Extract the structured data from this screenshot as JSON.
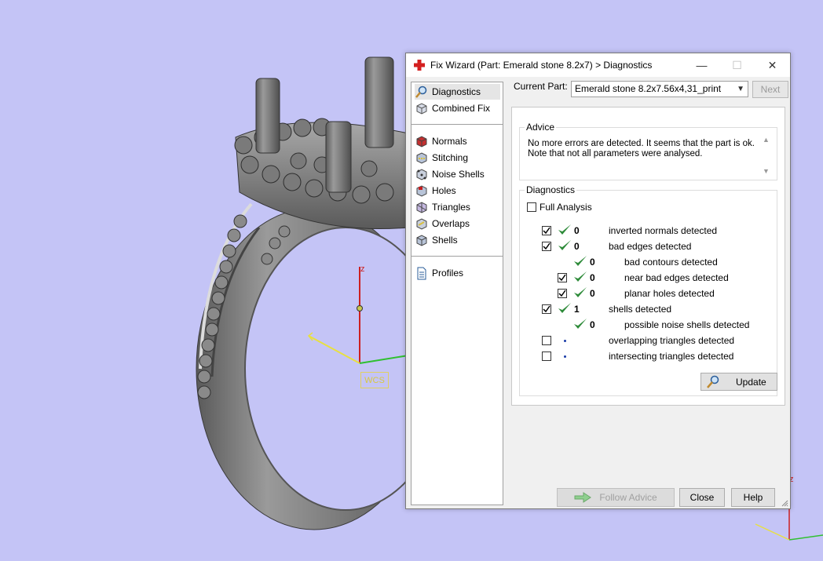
{
  "viewport": {
    "wcs_label": "WCS",
    "axis_z": "z",
    "corner_z": "z"
  },
  "dialog": {
    "title": "Fix Wizard (Part: Emerald stone 8.2x7) > Diagnostics",
    "controls": {
      "minimize": "—",
      "maximize": "☐",
      "close": "✕"
    }
  },
  "nav": {
    "items_top": [
      {
        "label": "Diagnostics",
        "icon": "magnifier-icon",
        "selected": true
      },
      {
        "label": "Combined Fix",
        "icon": "cube-icon"
      }
    ],
    "items_mid": [
      {
        "label": "Normals",
        "icon": "normals-icon"
      },
      {
        "label": "Stitching",
        "icon": "stitching-icon"
      },
      {
        "label": "Noise Shells",
        "icon": "noise-shells-icon"
      },
      {
        "label": "Holes",
        "icon": "holes-icon"
      },
      {
        "label": "Triangles",
        "icon": "triangles-icon"
      },
      {
        "label": "Overlaps",
        "icon": "overlaps-icon"
      },
      {
        "label": "Shells",
        "icon": "shells-icon"
      }
    ],
    "items_bottom": [
      {
        "label": "Profiles",
        "icon": "document-icon"
      }
    ]
  },
  "current_part": {
    "label": "Current Part:",
    "value": "Emerald stone 8.2x7.56x4,31_print",
    "next_label": "Next"
  },
  "advice": {
    "title": "Advice",
    "line1": "No more errors are detected. It seems that the part is ok.",
    "line2": "Note that not all parameters were analysed."
  },
  "diagnostics": {
    "title": "Diagnostics",
    "full_analysis": "Full Analysis",
    "rows": [
      {
        "checkbox": true,
        "checked": true,
        "status": "ok",
        "count": "0",
        "label": "inverted normals detected",
        "indent": 0
      },
      {
        "checkbox": true,
        "checked": true,
        "status": "ok",
        "count": "0",
        "label": "bad edges detected",
        "indent": 0
      },
      {
        "checkbox": false,
        "checked": false,
        "status": "ok",
        "count": "0",
        "label": "bad contours detected",
        "indent": 1
      },
      {
        "checkbox": true,
        "checked": true,
        "status": "ok",
        "count": "0",
        "label": "near bad edges detected",
        "indent": 1
      },
      {
        "checkbox": true,
        "checked": true,
        "status": "ok",
        "count": "0",
        "label": "planar holes detected",
        "indent": 1
      },
      {
        "checkbox": true,
        "checked": true,
        "status": "ok",
        "count": "1",
        "label": "shells detected",
        "indent": 0
      },
      {
        "checkbox": false,
        "checked": false,
        "status": "ok",
        "count": "0",
        "label": "possible noise shells detected",
        "indent": 1
      },
      {
        "checkbox": true,
        "checked": false,
        "status": "pending",
        "count": "",
        "label": "overlapping triangles detected",
        "indent": 0
      },
      {
        "checkbox": true,
        "checked": false,
        "status": "pending",
        "count": "",
        "label": "intersecting triangles detected",
        "indent": 0
      }
    ],
    "update_label": "Update"
  },
  "footer": {
    "follow_advice": "Follow Advice",
    "close": "Close",
    "help": "Help"
  },
  "colors": {
    "background": "#c4c4f6",
    "tick_green": "#2e8b3a",
    "axis_red": "#cc2020",
    "axis_yellow": "#e8e040",
    "axis_green": "#30c030"
  }
}
